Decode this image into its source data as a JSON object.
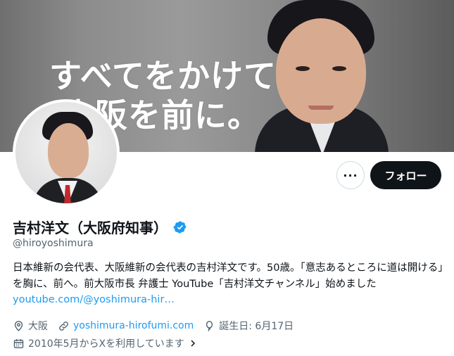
{
  "banner": {
    "line1": "すべてをかけて、",
    "line2": "大阪を前に。"
  },
  "actions": {
    "more_label": "···",
    "follow_label": "フォロー"
  },
  "profile": {
    "display_name": "吉村洋文（大阪府知事）",
    "handle": "@hiroyoshimura",
    "bio_text": "日本維新の会代表、大阪維新の会代表の吉村洋文です。50歳。「意志あるところに道は開ける」を胸に、前へ。前大阪市長 弁護士 YouTube「吉村洋文チャンネル」始めました",
    "bio_link": "youtube.com/@yoshimura-hir…"
  },
  "meta": {
    "location": "大阪",
    "website": "yoshimura-hirofumi.com",
    "birthday": "誕生日: 6月17日",
    "joined": "2010年5月からXを利用しています"
  },
  "colors": {
    "accent": "#1d9bf0",
    "text": "#0f1419",
    "secondary": "#536471",
    "follow_bg": "#0f1419"
  },
  "icons": [
    "verified-badge-icon",
    "location-pin-icon",
    "link-icon",
    "balloon-icon",
    "calendar-icon",
    "chevron-right-icon"
  ]
}
